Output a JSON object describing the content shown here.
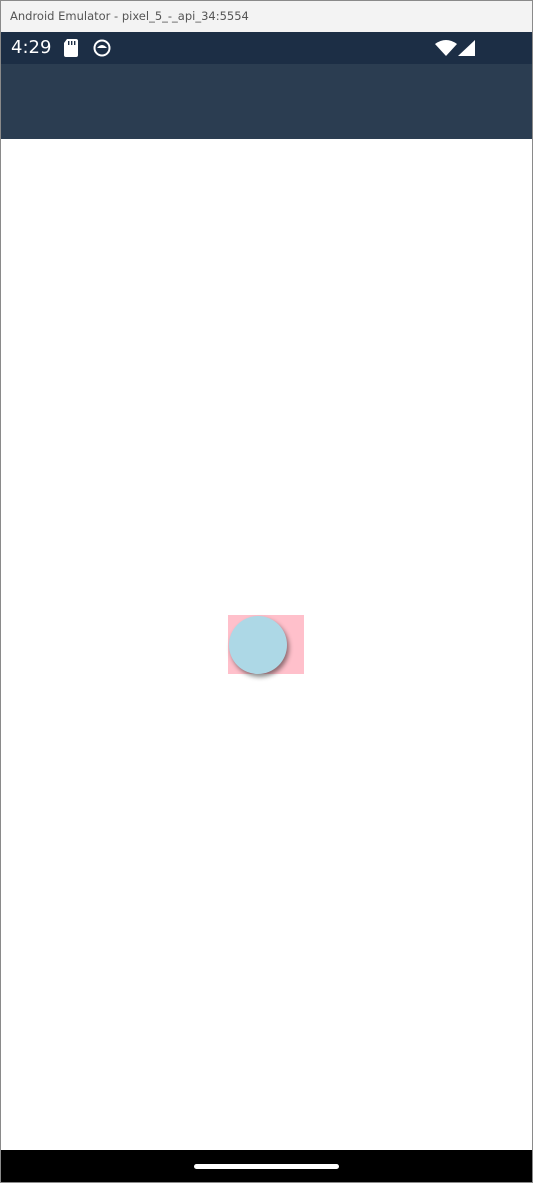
{
  "window": {
    "title": "Android Emulator - pixel_5_-_api_34:5554"
  },
  "status_bar": {
    "time": "4:29",
    "icons": [
      "sd-card-icon",
      "notification-icon",
      "wifi-icon",
      "cellular-signal-icon"
    ]
  },
  "colors": {
    "status_bar": "#1c2e45",
    "app_bar": "#2b3d51",
    "box": "#ffc0cb",
    "circle": "#add8e6",
    "nav_bar": "#000000"
  }
}
